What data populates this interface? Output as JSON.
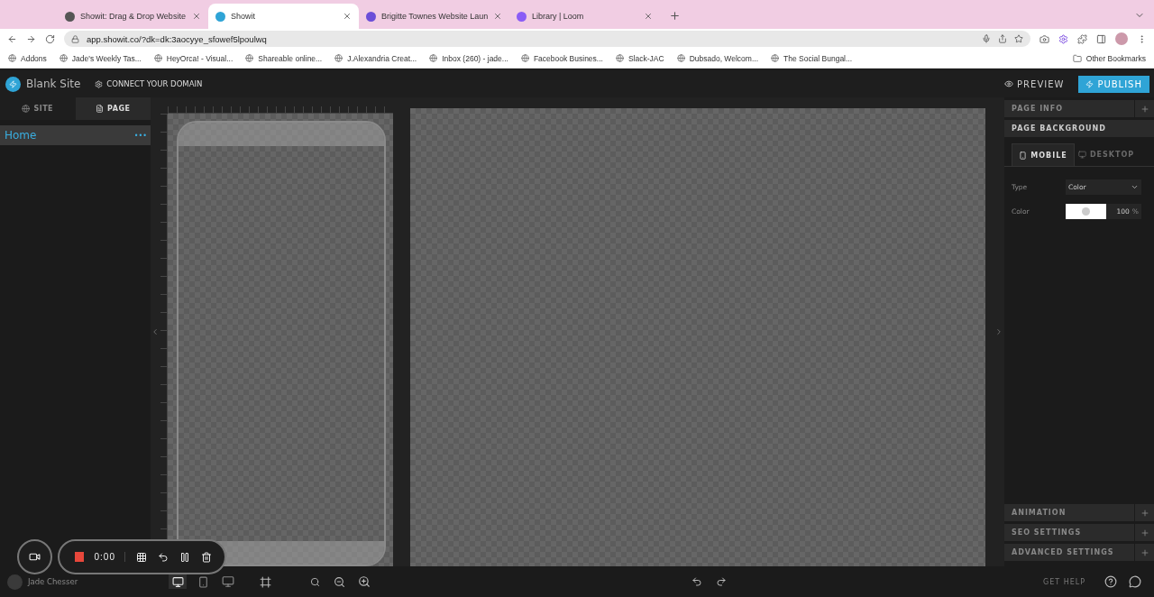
{
  "browser": {
    "tabs": [
      {
        "title": "Showit: Drag & Drop Website",
        "selected": false
      },
      {
        "title": "Showit",
        "selected": true
      },
      {
        "title": "Brigitte Townes Website Laun",
        "selected": false
      },
      {
        "title": "Library | Loom",
        "selected": false
      }
    ],
    "url": "app.showit.co/?dk=dk:3aocyye_sfowef5lpoulwq",
    "bookmarks": [
      "Addons",
      "Jade's Weekly Tas...",
      "HeyOrca! - Visual...",
      "Shareable online...",
      "J.Alexandria Creat...",
      "Inbox (260) - jade...",
      "Facebook Busines...",
      "Slack-JAC",
      "Dubsado, Welcom...",
      "The Social Bungal..."
    ],
    "other_bookmarks": "Other Bookmarks"
  },
  "app": {
    "site_name": "Blank Site",
    "connect_domain": "CONNECT YOUR DOMAIN",
    "preview": "PREVIEW",
    "publish": "PUBLISH"
  },
  "sidebar": {
    "tabs": [
      {
        "label": "SITE",
        "kind": "site",
        "selected": false
      },
      {
        "label": "PAGE",
        "kind": "page",
        "selected": true
      }
    ],
    "pages": [
      {
        "name": "Home",
        "menu": "•••",
        "selected": true
      }
    ]
  },
  "right_panel": {
    "page_info": "PAGE INFO",
    "page_background": {
      "title": "PAGE BACKGROUND",
      "tabs": [
        {
          "label": "MOBILE",
          "kind": "mobile",
          "selected": true
        },
        {
          "label": "DESKTOP",
          "kind": "desktop",
          "selected": false
        }
      ],
      "type_label": "Type",
      "type_value": "Color",
      "color_label": "Color",
      "color": "#ffffff",
      "opacity": "100",
      "opacity_unit": "%"
    },
    "collapsed_sections": [
      "ANIMATION",
      "SEO SETTINGS",
      "ADVANCED SETTINGS"
    ]
  },
  "bottom_bar": {
    "user": "Jade Chesser",
    "view_modes": [
      {
        "kind": "both",
        "selected": true
      },
      {
        "kind": "mobile",
        "selected": false
      },
      {
        "kind": "desktop",
        "selected": false
      }
    ],
    "get_help": "GET HELP"
  },
  "recorder": {
    "time": "0:00"
  }
}
